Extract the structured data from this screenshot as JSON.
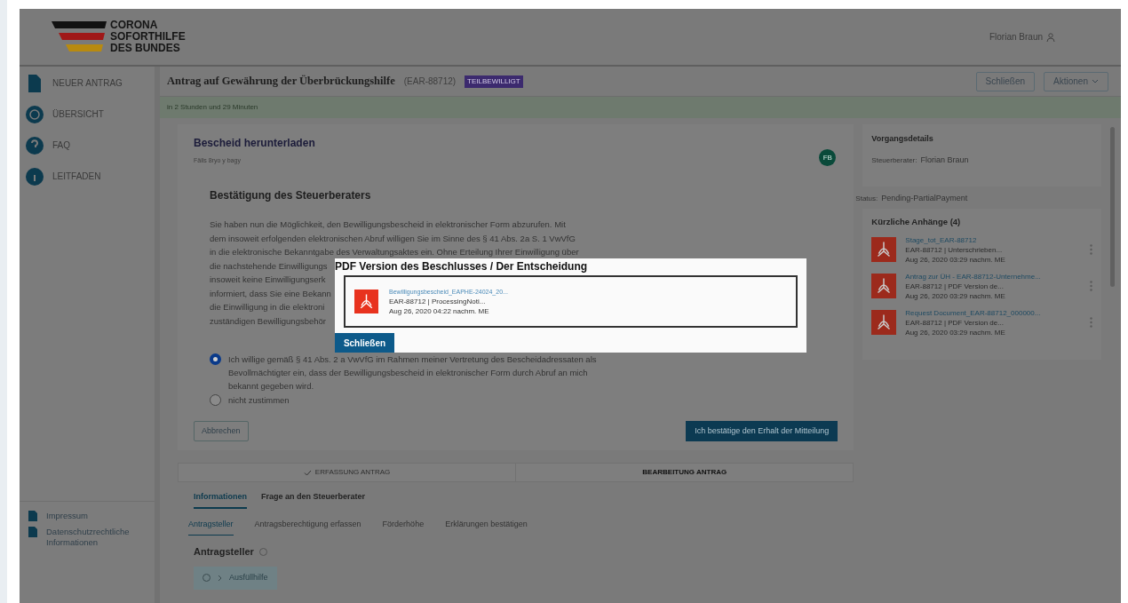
{
  "header": {
    "logo_lines": [
      "CORONA",
      "SOFORTHILFE",
      "DES BUNDES"
    ],
    "user": "Florian Braun"
  },
  "sidebar": {
    "items": [
      {
        "label": "NEUER ANTRAG",
        "kind": "doc",
        "selected": false
      },
      {
        "label": "ÜBERSICHT",
        "kind": "globe",
        "selected": false
      },
      {
        "label": "FAQ",
        "kind": "question",
        "selected": false
      },
      {
        "label": "LEITFADEN",
        "kind": "info",
        "selected": false
      }
    ],
    "footer_links": [
      "Impressum",
      "Datenschutzrechtliche Informationen"
    ]
  },
  "title_bar": {
    "title": "Antrag auf Gewährung der Überbrückungshilfe",
    "reference": "(EAR-88712)",
    "badge": "TEILBEWILLIGT",
    "buttons": [
      "Schließen",
      "Aktionen"
    ]
  },
  "notice": "in 2 Stunden und 29 Minuten",
  "task": {
    "title": "Bescheid herunterladen",
    "subtitle": "Fälls 8ryo y bagy",
    "avatar": "FB",
    "heading": "Bestätigung des Steuerberaters",
    "paragraph_lines": [
      "Sie haben nun die Möglichkeit, den Bewilligungsbescheid in elektronischer Form abzurufen. Mit",
      "dem insoweit erfolgenden elektronischen Abruf willigen Sie im Sinne des § 41 Abs. 2a S. 1 VwVfG",
      "in die elektronische Bekanntgabe des Verwaltungsaktes ein. Ohne Erteilung Ihrer Einwilligung über",
      "die nachstehende Einwilligungs",
      "insoweit keine Einwilligungserk",
      "informiert, dass Sie eine Bekann",
      "die Einwilligung in die elektroni",
      "zuständigen Bewilligungsbehör"
    ],
    "options": [
      {
        "label": "Ich willige gemäß § 41 Abs. 2 a VwVfG im Rahmen meiner Vertretung des Bescheidadressaten als Bevollmächtigter ein, dass der Bewilligungsbescheid in elektronischer Form durch Abruf an mich bekannt gegeben wird.",
        "selected": true
      },
      {
        "label": "nicht zustimmen",
        "selected": false
      }
    ],
    "cancel": "Abbrechen",
    "confirm": "Ich bestätige den Erhalt der Mitteilung"
  },
  "steps": [
    {
      "label": "ERFASSUNG ANTRAG",
      "done": true
    },
    {
      "label": "BEARBEITUNG ANTRAG",
      "done": false
    }
  ],
  "tabs": [
    {
      "label": "Informationen",
      "selected": true
    },
    {
      "label": "Frage an den Steuerberater",
      "selected": false
    }
  ],
  "subtabs": [
    {
      "label": "Antragsteller",
      "selected": true
    },
    {
      "label": "Antragsberechtigung erfassen",
      "selected": false
    },
    {
      "label": "Förderhöhe",
      "selected": false
    },
    {
      "label": "Erklärungen bestätigen",
      "selected": false
    }
  ],
  "section": {
    "title": "Antragsteller",
    "help": "Ausfüllhilfe"
  },
  "details": {
    "title": "Vorgangsdetails",
    "label": "Steuerberater:",
    "value": "Florian Braun",
    "status_label": "Status:",
    "status": "Pending-PartialPayment"
  },
  "attachments": {
    "title": "Kürzliche Anhänge (4)",
    "items": [
      {
        "name": "Stage_tot_EAR-88712",
        "meta": "EAR-88712 | Unterschrieben...",
        "date": "Aug 26, 2020 03:29 nachm. ME"
      },
      {
        "name": "Antrag zur ÜH - EAR-88712-Unternehme...",
        "meta": "EAR-88712 | PDF Version de...",
        "date": "Aug 26, 2020 03:29 nachm. ME"
      },
      {
        "name": "Request Document_EAR-88712_000000...",
        "meta": "EAR-88712 | PDF Version de...",
        "date": "Aug 26, 2020 03:29 nachm. ME"
      }
    ]
  },
  "modal": {
    "title": "PDF Version des Beschlusses / Der Entscheidung",
    "file": {
      "name": "Bewilligungsbescheid_EAPHE-24024_20...",
      "meta": "EAR-88712 | ProcessingNoti...",
      "date": "Aug 26, 2020 04:22 nachm. ME"
    },
    "button": "Schließen"
  }
}
